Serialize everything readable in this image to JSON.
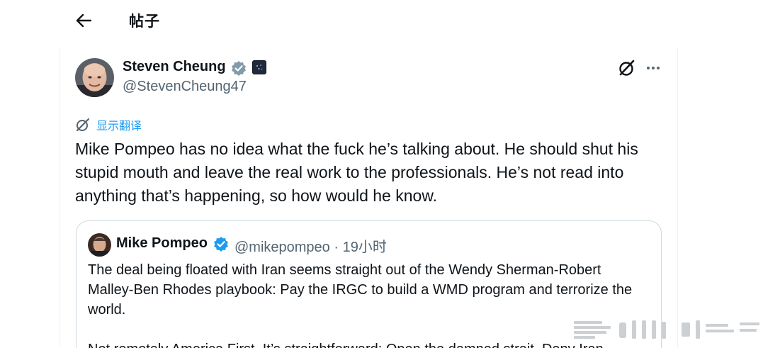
{
  "header": {
    "title": "帖子"
  },
  "author": {
    "name": "Steven Cheung",
    "handle": "@StevenCheung47"
  },
  "translate_label": "显示翻译",
  "tweet_text": "Mike Pompeo has no idea what the fuck he’s talking about. He should shut his stupid mouth and leave the real work to the professionals. He’s not read into anything that’s happening, so how would he know.",
  "quote": {
    "name": "Mike Pompeo",
    "handle": "@mikepompeo",
    "separator": " · ",
    "time": "19小时",
    "paragraphs": [
      "The deal being floated with Iran seems straight out of the Wendy Sherman-Robert Malley-Ben Rhodes playbook: Pay the IRGC to build a WMD program and terrorize the world.",
      "Not remotely America First. It’s straightforward: Open the damned strait. Deny Iran"
    ]
  },
  "colors": {
    "text": "#0f1419",
    "secondary": "#536471",
    "accent": "#1d9bf0",
    "border": "#cfd9de"
  },
  "icons": {
    "back": "arrow-left-icon",
    "verified": "verified-badge-icon",
    "grok": "grok-icon",
    "more": "more-horizontal-icon",
    "translate": "translate-icon"
  }
}
